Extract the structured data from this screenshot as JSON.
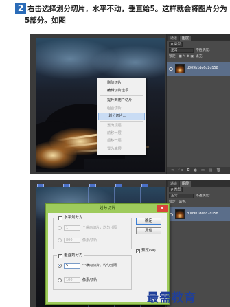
{
  "step": {
    "number": "2",
    "text": "右击选择划分切片，水平不动，垂直给5。这样就会将图片分为5部分。如图"
  },
  "context_menu": {
    "items": [
      {
        "label": "删除切片",
        "disabled": false
      },
      {
        "label": "编辑切片选项...",
        "disabled": false
      },
      {
        "sep": true
      },
      {
        "label": "提升到用户切片",
        "disabled": false
      },
      {
        "label": "组合切片",
        "disabled": true
      },
      {
        "label": "划分切片...",
        "disabled": false,
        "selected": true
      },
      {
        "sep": true
      },
      {
        "label": "置为顶层",
        "disabled": true
      },
      {
        "label": "前移一层",
        "disabled": true
      },
      {
        "label": "后移一层",
        "disabled": true
      },
      {
        "label": "置为底层",
        "disabled": true
      }
    ]
  },
  "layers_panel": {
    "tabs": [
      "通道",
      "图层"
    ],
    "kind_label": "ρ 类型",
    "blend_mode": "正常",
    "opacity_label": "不透明度:",
    "lock_label": "锁定:",
    "fill_label": "填充:",
    "layer_name": "d009b1de6d2d158",
    "footer": "∞ fx ◘ ◐ ▭ ▤ 🗑"
  },
  "dialog": {
    "title": "划分切片",
    "close": "x",
    "horizontal": {
      "label": "水平划分为",
      "checked": false,
      "value1": "1",
      "unit1": "个纵向切片，均匀分隔",
      "value2": "800",
      "unit2": "像素/切片"
    },
    "vertical": {
      "label": "垂直划分为",
      "checked": true,
      "value1": "5",
      "unit1": "个横向切片，均匀分隔",
      "value2": "100",
      "unit2": "像素/切片"
    },
    "ok": "确定",
    "reset": "复位",
    "preview_label": "预览(W)",
    "preview_checked": true
  },
  "watermark": "最需教育"
}
